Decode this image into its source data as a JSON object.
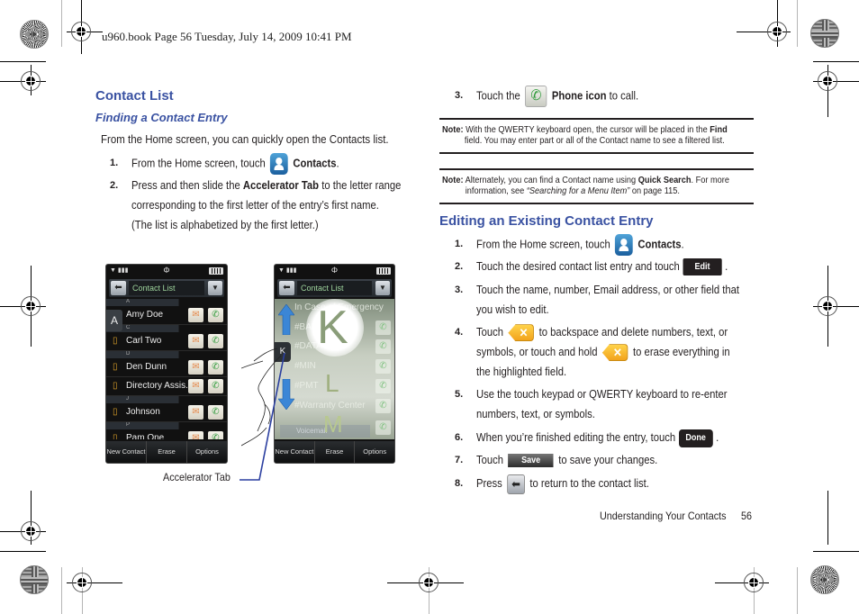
{
  "slug": "u960.book  Page 56  Tuesday, July 14, 2009  10:41 PM",
  "left_column": {
    "heading": "Contact List",
    "subheading": "Finding a Contact Entry",
    "intro": "From the Home screen, you can quickly open the Contacts list.",
    "steps": [
      {
        "num": "1.",
        "pre": "From the Home screen, touch",
        "icon": "contacts-icon",
        "bold": "Contacts",
        "post": "."
      },
      {
        "num": "2.",
        "pre": "Press and then slide the",
        "bold": "Accelerator Tab",
        "post": "to the letter range",
        "line2": "corresponding to the first letter of the entry’s first name.",
        "line3": "(The list is alphabetized by the first letter.)"
      }
    ],
    "callout": "Accelerator Tab"
  },
  "phone_left": {
    "title": "Contact List",
    "tab_letter": "A",
    "sections": [
      {
        "letter": "A",
        "contacts": [
          "Amy Doe"
        ]
      },
      {
        "letter": "C",
        "contacts": [
          "Carl Two"
        ]
      },
      {
        "letter": "D",
        "contacts": [
          "Den Dunn",
          "Directory Assis..."
        ]
      },
      {
        "letter": "J",
        "contacts": [
          "Johnson"
        ]
      },
      {
        "letter": "P",
        "contacts": [
          "Pam One"
        ]
      }
    ],
    "bottom_buttons": [
      "New Contact",
      "Erase",
      "Options"
    ]
  },
  "phone_right": {
    "title": "Contact List",
    "tab_letter": "K",
    "big_letter": "K",
    "next_letters": [
      "L",
      "M"
    ],
    "faded_entries": [
      "In Case of Emergency",
      "#BAL",
      "#DATA",
      "#MIN",
      "#PMT",
      "#Warranty Center",
      "Voicemail"
    ],
    "bottom_buttons": [
      "New Contact",
      "Erase",
      "Options"
    ]
  },
  "right_column": {
    "step3": {
      "num": "3.",
      "pre": "Touch the",
      "icon": "phone-icon",
      "bold": "Phone icon",
      "post": "to call."
    },
    "note1": {
      "label": "Note:",
      "line1_pre": "With the QWERTY keyboard open, the cursor will be placed in the",
      "line1_bold": "Find",
      "line2": "field. You may enter part or all of the Contact name to see a filtered list."
    },
    "note2": {
      "label": "Note:",
      "line1_pre": "Alternately, you can find a Contact name using",
      "line1_bold": "Quick Search",
      "line1_post": ". For more",
      "line2_pre": "information, see",
      "line2_italic": "“Searching for a Menu Item”",
      "line2_post": "on page 115."
    },
    "heading": "Editing an Existing Contact Entry",
    "steps": [
      {
        "num": "1.",
        "pre": "From the Home screen, touch",
        "bold": "Contacts",
        "post": "."
      },
      {
        "num": "2.",
        "pre": "Touch the desired contact list entry and touch",
        "button": "Edit",
        "post": "."
      },
      {
        "num": "3.",
        "line1": "Touch the name, number, Email address, or other field that",
        "line2": "you wish to edit."
      },
      {
        "num": "4.",
        "pre": "Touch",
        "post": "to backspace and delete numbers, text, or",
        "line2_pre": "symbols, or touch and hold",
        "line2_post": "to erase everything in",
        "line3": "the highlighted field."
      },
      {
        "num": "5.",
        "line1": "Use the touch keypad or QWERTY keyboard to re-enter",
        "line2": "numbers, text, or symbols."
      },
      {
        "num": "6.",
        "pre": "When you’re finished editing the entry, touch",
        "button": "Done",
        "post": "."
      },
      {
        "num": "7.",
        "pre": "Touch",
        "button": "Save",
        "post": "to save your changes."
      },
      {
        "num": "8.",
        "pre": "Press",
        "post": "to return to the contact list."
      }
    ]
  },
  "footer": {
    "section": "Understanding Your Contacts",
    "page": "56"
  },
  "colors": {
    "heading": "#3a52a2",
    "callout_line": "#2b3fa0",
    "arrow": "#3b86d6"
  }
}
